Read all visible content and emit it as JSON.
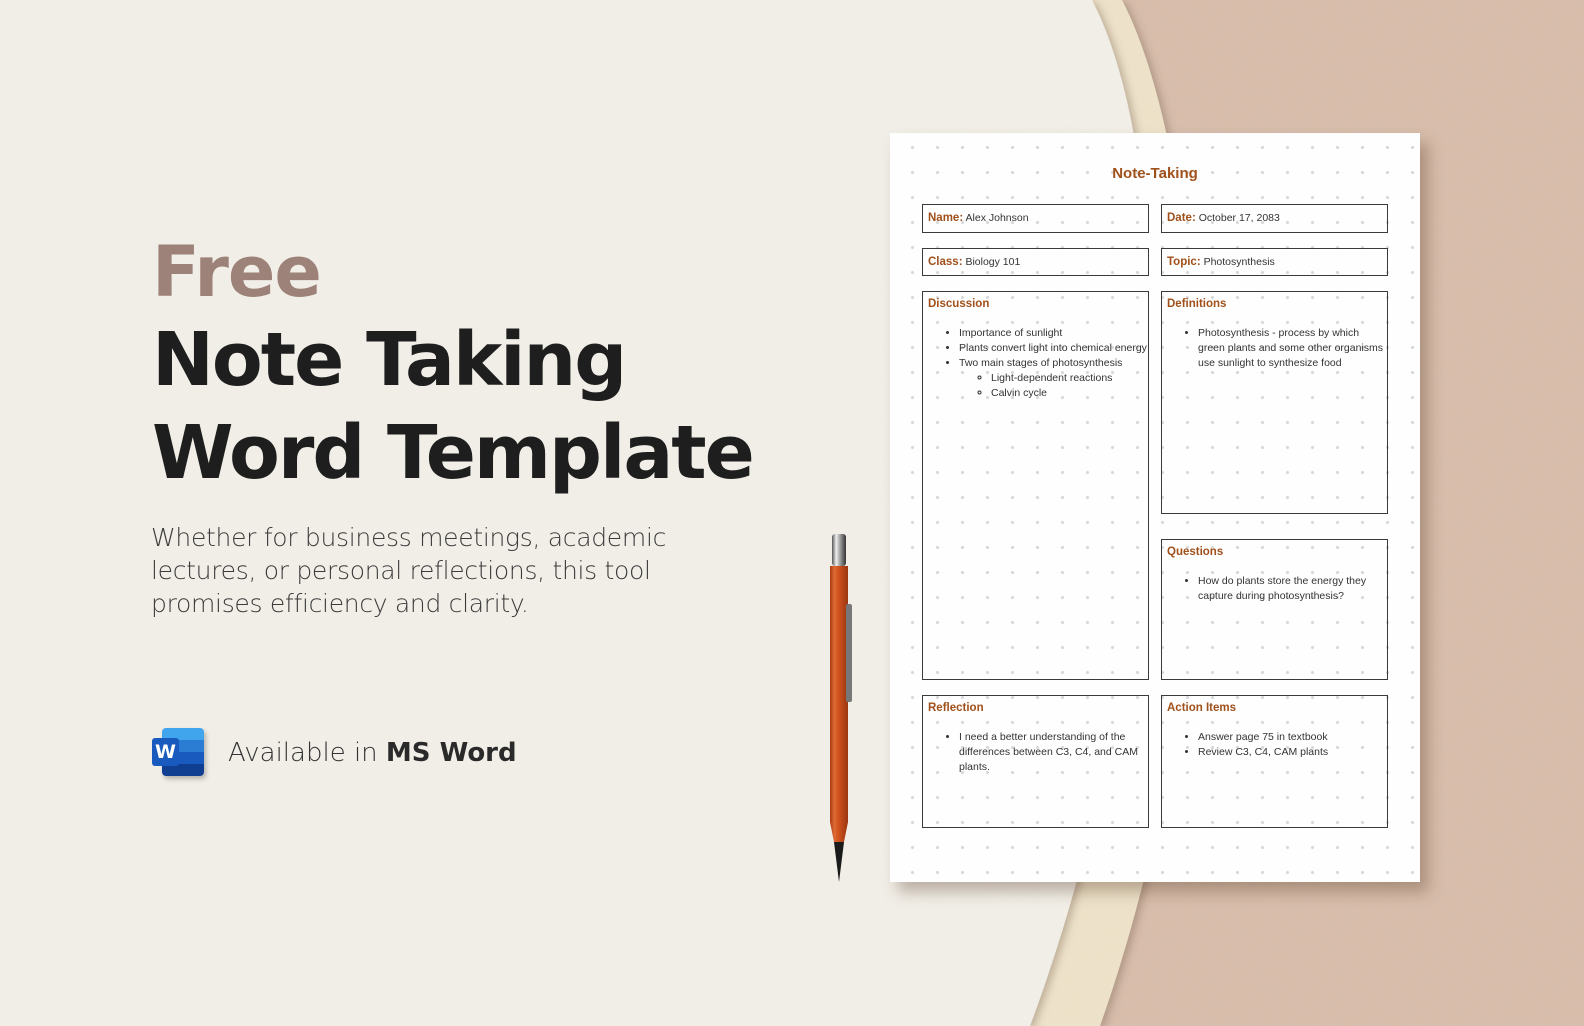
{
  "hero": {
    "badge": "Free",
    "title_line1": "Note Taking",
    "title_line2": "Word Template",
    "subtitle": "Whether for business meetings, academic lectures, or personal reflections, this tool promises efficiency and clarity.",
    "available_prefix": "Available in ",
    "available_app": "MS Word",
    "app_icon_letter": "W"
  },
  "colors": {
    "accent": "#a0501a",
    "badge": "#9c8278",
    "title": "#1e1e1e",
    "background_cream": "#f2efe8",
    "background_band": "#eee2c9",
    "background_tan": "#d8bdab",
    "pen": "#d2541f"
  },
  "document": {
    "title": "Note-Taking",
    "fields": {
      "name_label": "Name",
      "name_value": "Alex Johnson",
      "date_label": "Date",
      "date_value": "October 17, 2083",
      "class_label": "Class",
      "class_value": "Biology 101",
      "topic_label": "Topic",
      "topic_value": "Photosynthesis"
    },
    "sections": {
      "discussion": {
        "title": "Discussion",
        "items": [
          "Importance of sunlight",
          "Plants convert light into chemical energy",
          "Two main stages of photosynthesis"
        ],
        "subitems": [
          "Light-dependent reactions",
          "Calvin cycle"
        ]
      },
      "definitions": {
        "title": "Definitions",
        "items": [
          "Photosynthesis - process by which green plants and some other organisms use sunlight to synthesize food"
        ]
      },
      "questions": {
        "title": "Questions",
        "items": [
          "How do plants store the energy they capture during photosynthesis?"
        ]
      },
      "reflection": {
        "title": "Reflection",
        "items": [
          "I need a better understanding of the differences between C3, C4, and CAM plants."
        ]
      },
      "action_items": {
        "title": "Action Items",
        "items": [
          "Answer page 75 in textbook",
          "Review C3, C4, CAM plants"
        ]
      }
    }
  }
}
